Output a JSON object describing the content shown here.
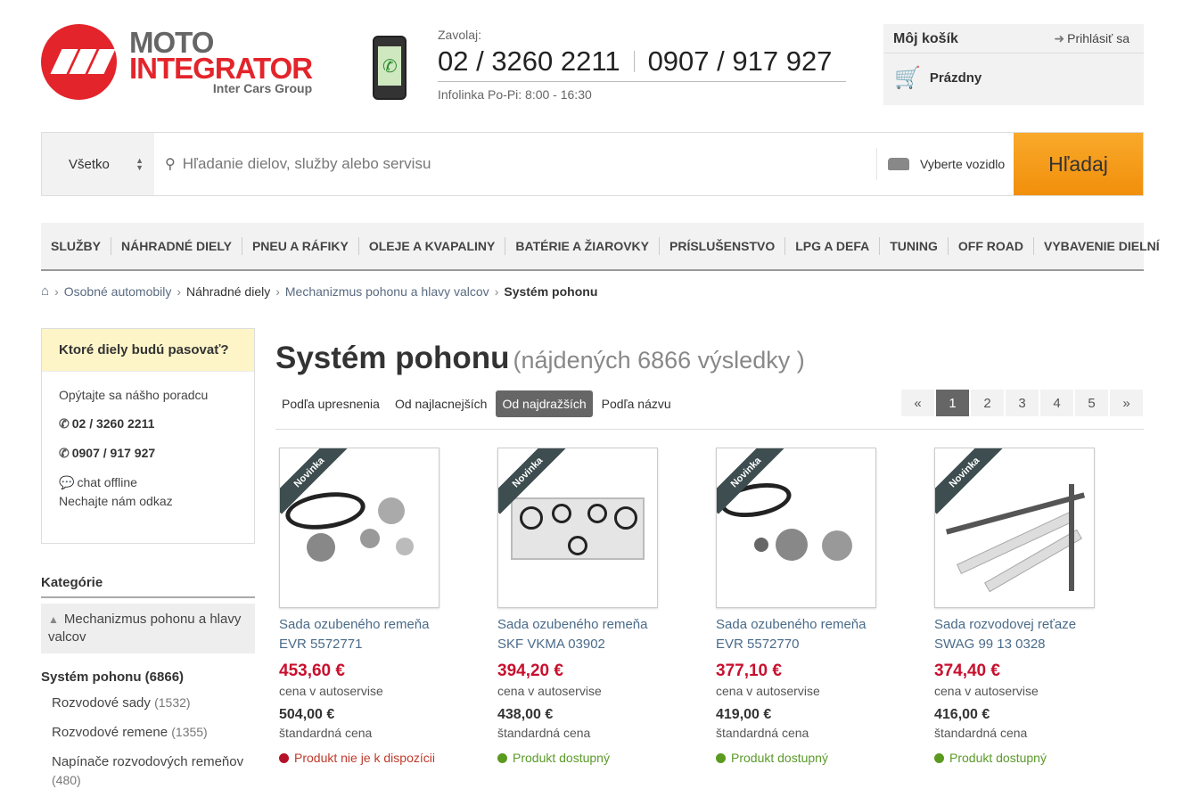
{
  "header": {
    "logo_top": "MOTO",
    "logo_bottom": "INTEGRATOR",
    "logo_sub": "Inter Cars Group",
    "call_label": "Zavolaj:",
    "phone1": "02 / 3260 2211",
    "phone2": "0907 / 917 927",
    "hotline": "Infolinka Po-Pi: 8:00 - 16:30"
  },
  "cart": {
    "title": "Môj košík",
    "login": "Prihlásiť sa",
    "status": "Prázdny"
  },
  "search": {
    "category": "Všetko",
    "placeholder": "Hľadanie dielov, služby alebo servisu",
    "vehicle": "Vyberte vozidlo",
    "button": "Hľadaj"
  },
  "nav": [
    "SLUŽBY",
    "NÁHRADNÉ DIELY",
    "PNEU A RÁFIKY",
    "OLEJE A KVAPALINY",
    "BATÉRIE A ŽIAROVKY",
    "PRÍSLUŠENSTVO",
    "LPG A DEFA",
    "TUNING",
    "OFF ROAD",
    "VYBAVENIE DIELNÍ"
  ],
  "breadcrumb": [
    "Osobné automobily",
    "Náhradné diely",
    "Mechanizmus pohonu a hlavy valcov",
    "Systém pohonu"
  ],
  "advisor": {
    "title": "Ktoré diely budú pasovať?",
    "ask": "Opýtajte sa nášho poradcu",
    "phone1": "02 / 3260 2211",
    "phone2": "0907 / 917 927",
    "chat": "chat offline",
    "message": "Nechajte nám odkaz"
  },
  "categories": {
    "title": "Kategórie",
    "parent": "Mechanizmus pohonu a hlavy valcov",
    "current": "Systém pohonu (6866)",
    "subs": [
      {
        "name": "Rozvodové sady",
        "count": "(1532)"
      },
      {
        "name": "Rozvodové remene",
        "count": "(1355)"
      },
      {
        "name": "Napínače rozvodových remeňov",
        "count": "(480)"
      }
    ]
  },
  "main": {
    "title": "Systém pohonu",
    "results": "(nájdených 6866 výsledky )",
    "sorts": [
      "Podľa upresnenia",
      "Od najlacnejších",
      "Od najdražších",
      "Podľa názvu"
    ],
    "pages": [
      "«",
      "1",
      "2",
      "3",
      "4",
      "5",
      "»"
    ]
  },
  "badge": "Novinka",
  "price_label": "cena v autoservise",
  "std_label": "štandardná cena",
  "products": [
    {
      "name1": "Sada ozubeného remeňa",
      "name2": "EVR 5572771",
      "price": "453,60 €",
      "std": "504,00 €",
      "avail": "Produkt nie je k dispozícii"
    },
    {
      "name1": "Sada ozubeného remeňa",
      "name2": "SKF VKMA 03902",
      "price": "394,20 €",
      "std": "438,00 €",
      "avail": "Produkt dostupný"
    },
    {
      "name1": "Sada ozubeného remeňa",
      "name2": "EVR 5572770",
      "price": "377,10 €",
      "std": "419,00 €",
      "avail": "Produkt dostupný"
    },
    {
      "name1": "Sada rozvodovej reťaze",
      "name2": "SWAG 99 13 0328",
      "price": "374,40 €",
      "std": "416,00 €",
      "avail": "Produkt dostupný"
    }
  ]
}
